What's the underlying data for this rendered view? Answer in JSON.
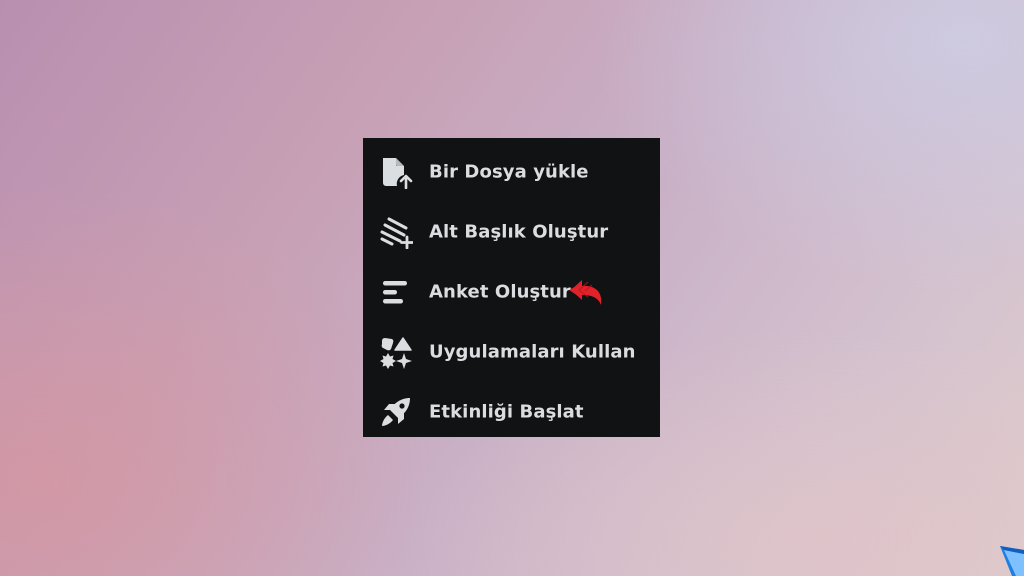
{
  "menu": {
    "items": [
      {
        "label": "Bir Dosya yükle",
        "icon": "file-upload-icon"
      },
      {
        "label": "Alt Başlık Oluştur",
        "icon": "thread-create-icon"
      },
      {
        "label": "Anket Oluştur",
        "icon": "poll-icon"
      },
      {
        "label": "Uygulamaları Kullan",
        "icon": "apps-icon"
      },
      {
        "label": "Etkinliği Başlat",
        "icon": "rocket-icon"
      }
    ]
  },
  "colors": {
    "menu_bg": "#111214",
    "text": "#dbdee1",
    "icon": "#dbdee1",
    "highlight_arrow": "#e0222a"
  }
}
